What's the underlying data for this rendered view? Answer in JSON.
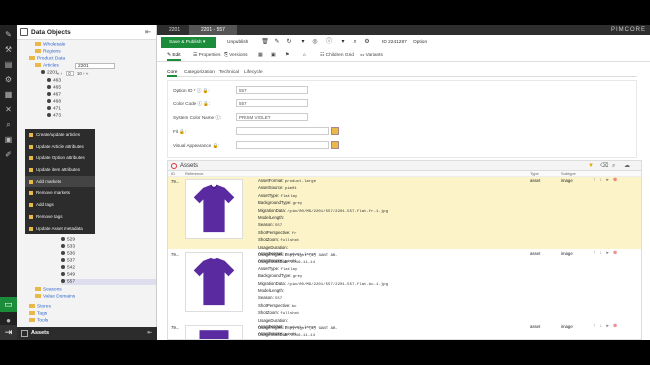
{
  "tree": {
    "title": "Data Objects",
    "items": [
      {
        "label": "Wholesale",
        "kind": "folder"
      },
      {
        "label": "Regions",
        "kind": "folder"
      },
      {
        "label": "Product Data",
        "kind": "folder"
      },
      {
        "label": "Articles",
        "kind": "folder"
      },
      {
        "label": "2201",
        "kind": "object"
      },
      {
        "label": "463",
        "kind": "object"
      },
      {
        "label": "465",
        "kind": "object"
      },
      {
        "label": "467",
        "kind": "object"
      },
      {
        "label": "468",
        "kind": "object"
      },
      {
        "label": "471",
        "kind": "object"
      },
      {
        "label": "473",
        "kind": "object"
      }
    ],
    "articles_input": "2201",
    "pager": {
      "page": "0",
      "total": "10"
    },
    "lower_items": [
      {
        "label": "524"
      },
      {
        "label": "529"
      },
      {
        "label": "533"
      },
      {
        "label": "536"
      },
      {
        "label": "537"
      },
      {
        "label": "542"
      },
      {
        "label": "549"
      },
      {
        "label": "557"
      }
    ],
    "bottom_folders": [
      "Seasons",
      "Value Domains",
      "Stores",
      "Tags",
      "Tools"
    ]
  },
  "context_menu": [
    "Create/update articles",
    "Update Article attributes",
    "Update Option attributes",
    "Update item attributes",
    "Add markets",
    "Remove markets",
    "Add tags",
    "Remove tags",
    "Update Asset metadata"
  ],
  "assets_panel_title": "Assets",
  "tabs": [
    {
      "label": "2201"
    },
    {
      "label": "2201 - 557"
    }
  ],
  "logo": "PIMCORE",
  "toolbar": {
    "save_publish": "Save & Publish",
    "unpublish": "Unpublish",
    "id_label": "ID 2241287",
    "option_label": "Option"
  },
  "subtabs": [
    "Edit",
    "Properties",
    "Versions",
    "Children Grid",
    "Variants"
  ],
  "subtabs2": [
    "Core",
    "Categorization",
    "Technical",
    "Lifecycle"
  ],
  "form": {
    "option_id_label": "Option ID * ",
    "option_id_value": "557",
    "color_code_label": "Color Code ",
    "color_code_value": "557",
    "system_color_label": "System Color Name ",
    "system_color_value": "PRISM VIOLET",
    "fit_label": "Fit ",
    "visual_label": "Visual Appearance "
  },
  "assets": {
    "title": "Assets",
    "columns": {
      "id": "ID",
      "reference": "Reference",
      "type": "Type",
      "subtype": "Subtype"
    },
    "rows": [
      {
        "id": "79...",
        "type": "asset",
        "subtype": "image",
        "highlight": true,
        "meta": [
          [
            "AssetFormat:",
            "product-large"
          ],
          [
            "AssetSource:",
            "pim01"
          ],
          [
            "AssetType:",
            "flatlay"
          ],
          [
            "BackgroundType:",
            "grey"
          ],
          [
            "MigrationData:",
            "/pim/00/MG/2201/557/2201-557-flat-fr-1.jpg"
          ],
          [
            "ModelLength:",
            ""
          ],
          [
            "Season:",
            "557"
          ],
          [
            "ShotPerspective:",
            "fr"
          ],
          [
            "ShotZoom:",
            "fullshot"
          ],
          [
            "UsageDuration:",
            ""
          ],
          [
            "UsageRights:",
            "Copyright (c) GANT AB."
          ],
          [
            "UsageStartDate:",
            "2016-11-14"
          ]
        ]
      },
      {
        "id": "79...",
        "type": "asset",
        "subtype": "image",
        "highlight": false,
        "meta": [
          [
            "AssetFormat:",
            "product-large"
          ],
          [
            "AssetSource:",
            "pim01"
          ],
          [
            "AssetType:",
            "flatlay"
          ],
          [
            "BackgroundType:",
            "grey"
          ],
          [
            "MigrationData:",
            "/pim/00/MG/2201/557/2201-557-flat-bc-1.jpg"
          ],
          [
            "ModelLength:",
            ""
          ],
          [
            "Season:",
            "557"
          ],
          [
            "ShotPerspective:",
            "bc"
          ],
          [
            "ShotZoom:",
            "fullshot"
          ],
          [
            "UsageDuration:",
            ""
          ],
          [
            "UsageRights:",
            "Copyright (c) GANT AB."
          ],
          [
            "UsageStartDate:",
            "2016-11-14"
          ]
        ]
      },
      {
        "id": "79...",
        "type": "asset",
        "subtype": "image",
        "highlight": false,
        "meta": [
          [
            "AssetFormat:",
            "product-large"
          ],
          [
            "AssetSource:",
            "pim01"
          ]
        ]
      }
    ]
  },
  "colors": {
    "green": "#1a8c3a",
    "shirt": "#5a2aa0",
    "highlight": "#fcf3c8",
    "dark": "#2c2c2c"
  }
}
